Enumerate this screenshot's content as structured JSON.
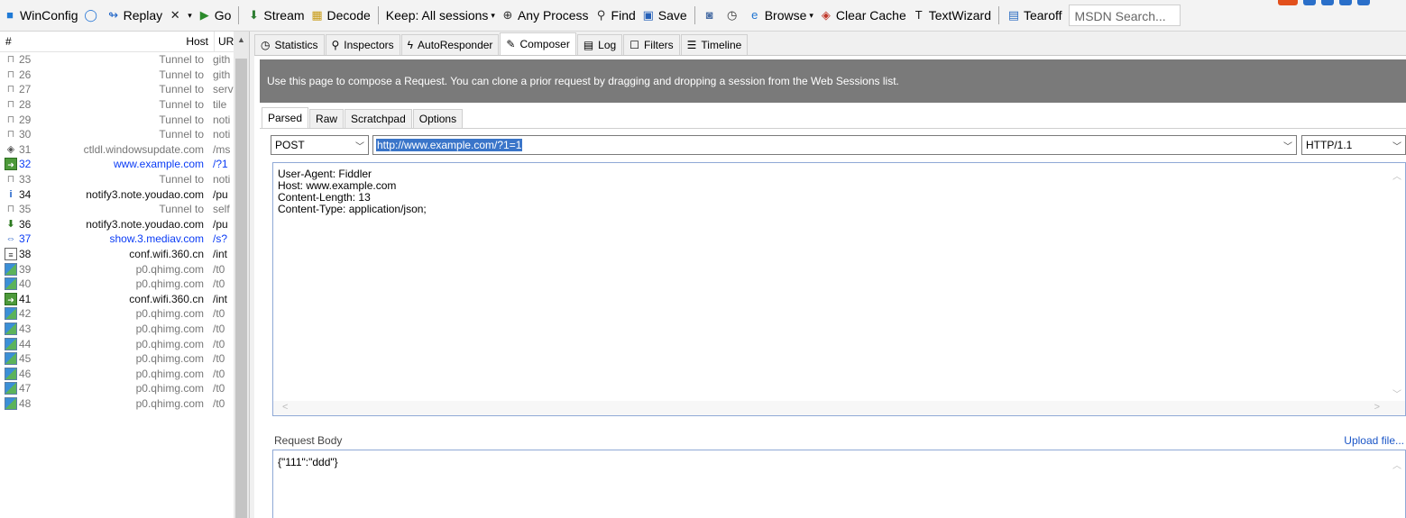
{
  "toolbar": {
    "items": [
      {
        "label": "WinConfig",
        "icon": "windows-icon",
        "glyph": "■",
        "color": "#1f7ad6",
        "caret": false
      },
      {
        "label": "",
        "icon": "comment-icon",
        "glyph": "◯",
        "color": "#2a78d6",
        "caret": false
      },
      {
        "label": "Replay",
        "icon": "replay-icon",
        "glyph": "↬",
        "color": "#1d63c7",
        "caret": false
      },
      {
        "label": "",
        "icon": "remove-icon",
        "glyph": "✕",
        "color": "#222",
        "caret": true
      },
      {
        "label": "Go",
        "icon": "go-icon",
        "glyph": "▶",
        "color": "#2b8a2b",
        "caret": false
      },
      {
        "sep": true
      },
      {
        "label": "Stream",
        "icon": "stream-icon",
        "glyph": "⬇",
        "color": "#2e7d32",
        "caret": false
      },
      {
        "label": "Decode",
        "icon": "decode-icon",
        "glyph": "▦",
        "color": "#c79a13",
        "caret": false
      },
      {
        "sep": true
      },
      {
        "label": "Keep: All sessions",
        "icon": "",
        "glyph": "",
        "color": "#222",
        "caret": true
      },
      {
        "label": "Any Process",
        "icon": "crosshair-icon",
        "glyph": "⊕",
        "color": "#333",
        "caret": false
      },
      {
        "label": "Find",
        "icon": "binoculars-icon",
        "glyph": "⚲",
        "color": "#333",
        "caret": false
      },
      {
        "label": "Save",
        "icon": "save-icon",
        "glyph": "▣",
        "color": "#2560b8",
        "caret": false
      },
      {
        "sep": true
      },
      {
        "label": "",
        "icon": "camera-icon",
        "glyph": "◙",
        "color": "#4b6fa5",
        "caret": false
      },
      {
        "label": "",
        "icon": "timer-icon",
        "glyph": "◷",
        "color": "#333",
        "caret": false
      },
      {
        "label": "Browse",
        "icon": "ie-icon",
        "glyph": "e",
        "color": "#1f74d1",
        "caret": true
      },
      {
        "label": "Clear Cache",
        "icon": "clear-cache-icon",
        "glyph": "◈",
        "color": "#c0392b",
        "caret": false
      },
      {
        "label": "TextWizard",
        "icon": "textwizard-icon",
        "glyph": "T",
        "color": "#111",
        "caret": false
      },
      {
        "sep": true
      },
      {
        "label": "Tearoff",
        "icon": "tearoff-icon",
        "glyph": "▤",
        "color": "#2d6ec2",
        "caret": false
      }
    ],
    "search_placeholder": "MSDN Search..."
  },
  "sessions": {
    "headers": {
      "num": "#",
      "host": "Host",
      "url": "UR"
    },
    "rows": [
      {
        "num": "25",
        "host": "Tunnel to",
        "url": "gith",
        "icon": "lock-icon",
        "style": "gray"
      },
      {
        "num": "26",
        "host": "Tunnel to",
        "url": "gith",
        "icon": "lock-icon",
        "style": "gray"
      },
      {
        "num": "27",
        "host": "Tunnel to",
        "url": "serv",
        "icon": "lock-icon",
        "style": "gray"
      },
      {
        "num": "28",
        "host": "Tunnel to",
        "url": "tile",
        "icon": "lock-icon",
        "style": "gray"
      },
      {
        "num": "29",
        "host": "Tunnel to",
        "url": "noti",
        "icon": "lock-icon",
        "style": "gray"
      },
      {
        "num": "30",
        "host": "Tunnel to",
        "url": "noti",
        "icon": "lock-icon",
        "style": "gray"
      },
      {
        "num": "31",
        "host": "ctldl.windowsupdate.com",
        "url": "/ms",
        "icon": "control-icon",
        "style": "gray"
      },
      {
        "num": "32",
        "host": "www.example.com",
        "url": "/?1",
        "icon": "post-icon",
        "style": "blue"
      },
      {
        "num": "33",
        "host": "Tunnel to",
        "url": "noti",
        "icon": "lock-icon",
        "style": "gray"
      },
      {
        "num": "34",
        "host": "notify3.note.youdao.com",
        "url": "/pu",
        "icon": "info-icon",
        "style": "dark"
      },
      {
        "num": "35",
        "host": "Tunnel to",
        "url": "self",
        "icon": "lock-icon",
        "style": "gray"
      },
      {
        "num": "36",
        "host": "notify3.note.youdao.com",
        "url": "/pu",
        "icon": "download-icon",
        "style": "dark"
      },
      {
        "num": "37",
        "host": "show.3.mediav.com",
        "url": "/s?",
        "icon": "swap-icon",
        "style": "blue"
      },
      {
        "num": "38",
        "host": "conf.wifi.360.cn",
        "url": "/int",
        "icon": "document-icon",
        "style": "dark"
      },
      {
        "num": "39",
        "host": "p0.qhimg.com",
        "url": "/t0",
        "icon": "image-icon",
        "style": "gray"
      },
      {
        "num": "40",
        "host": "p0.qhimg.com",
        "url": "/t0",
        "icon": "image-icon",
        "style": "gray"
      },
      {
        "num": "41",
        "host": "conf.wifi.360.cn",
        "url": "/int",
        "icon": "post-icon",
        "style": "dark"
      },
      {
        "num": "42",
        "host": "p0.qhimg.com",
        "url": "/t0",
        "icon": "image-icon",
        "style": "gray"
      },
      {
        "num": "43",
        "host": "p0.qhimg.com",
        "url": "/t0",
        "icon": "image-icon",
        "style": "gray"
      },
      {
        "num": "44",
        "host": "p0.qhimg.com",
        "url": "/t0",
        "icon": "image-icon",
        "style": "gray"
      },
      {
        "num": "45",
        "host": "p0.qhimg.com",
        "url": "/t0",
        "icon": "image-icon",
        "style": "gray"
      },
      {
        "num": "46",
        "host": "p0.qhimg.com",
        "url": "/t0",
        "icon": "image-icon",
        "style": "gray"
      },
      {
        "num": "47",
        "host": "p0.qhimg.com",
        "url": "/t0",
        "icon": "image-icon",
        "style": "gray"
      },
      {
        "num": "48",
        "host": "p0.qhimg.com",
        "url": "/t0",
        "icon": "image-icon",
        "style": "gray"
      }
    ]
  },
  "main_tabs": [
    {
      "label": "Statistics",
      "icon": "stopwatch-icon",
      "glyph": "◷",
      "active": false
    },
    {
      "label": "Inspectors",
      "icon": "inspectors-icon",
      "glyph": "⚲",
      "active": false
    },
    {
      "label": "AutoResponder",
      "icon": "lightning-icon",
      "glyph": "ϟ",
      "active": false
    },
    {
      "label": "Composer",
      "icon": "composer-icon",
      "glyph": "✎",
      "active": true
    },
    {
      "label": "Log",
      "icon": "log-icon",
      "glyph": "▤",
      "active": false
    },
    {
      "label": "Filters",
      "icon": "checkbox-icon",
      "glyph": "☐",
      "active": false
    },
    {
      "label": "Timeline",
      "icon": "timeline-icon",
      "glyph": "☰",
      "active": false
    }
  ],
  "composer": {
    "banner": "Use this page to compose a Request. You can clone a prior request by dragging and dropping a session from the Web Sessions list.",
    "sub_tabs": [
      {
        "label": "Parsed",
        "active": true
      },
      {
        "label": "Raw",
        "active": false
      },
      {
        "label": "Scratchpad",
        "active": false
      },
      {
        "label": "Options",
        "active": false
      }
    ],
    "method": "POST",
    "url": "http://www.example.com/?1=1",
    "version": "HTTP/1.1",
    "headers": [
      "User-Agent: Fiddler",
      "Host: www.example.com",
      "Content-Length: 13",
      "Content-Type: application/json;"
    ],
    "request_body_label": "Request Body",
    "upload_label": "Upload file...",
    "request_body": "{\"111\":\"ddd\"}"
  }
}
